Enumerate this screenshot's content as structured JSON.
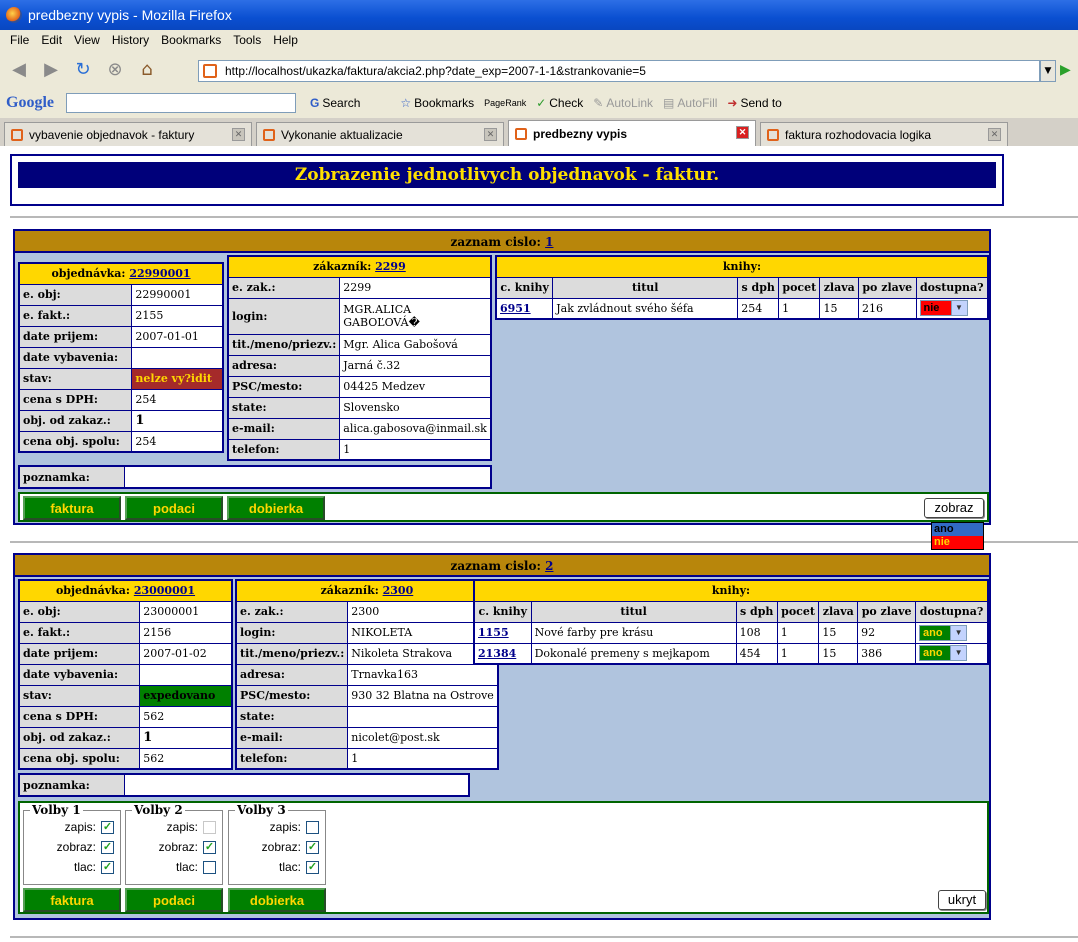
{
  "window": {
    "title": "predbezny vypis - Mozilla Firefox"
  },
  "menu": [
    "File",
    "Edit",
    "View",
    "History",
    "Bookmarks",
    "Tools",
    "Help"
  ],
  "url": "http://localhost/ukazka/faktura/akcia2.php?date_exp=2007-1-1&strankovanie=5",
  "toolbar": {
    "google": "Google",
    "search": "Search",
    "bookmarks": "Bookmarks",
    "pagerank": "PageRank",
    "check": "Check",
    "autolink": "AutoLink",
    "autofill": "AutoFill",
    "sendto": "Send to"
  },
  "tabs": [
    "vybavenie objednavok - faktury",
    "Vykonanie aktualizacie",
    "predbezny vypis",
    "faktura rozhodovacia logika"
  ],
  "page": {
    "header": "Zobrazenie jednotlivych objednavok - faktur."
  },
  "labels": {
    "zaznam": "zaznam cislo: ",
    "objednavka": "objednávka: ",
    "zakaznik": "zákazník: ",
    "knihy": "knihy:",
    "e_obj": "e. obj:",
    "e_fakt": "e. fakt.:",
    "date_prijem": "date prijem:",
    "date_vybavenia": "date vybavenia:",
    "stav": "stav:",
    "cena_dph": "cena s DPH:",
    "obj_zakaz": "obj. od zakaz.:",
    "cena_spolu": "cena obj. spolu:",
    "e_zak": "e. zak.:",
    "login": "login:",
    "tit": "tit./meno/priezv.:",
    "adresa": "adresa:",
    "psc": "PSC/mesto:",
    "state": "state:",
    "email": "e-mail:",
    "telefon": "telefon:",
    "poznamka": "poznamka:",
    "col_cknihy": "c. knihy",
    "col_titul": "titul",
    "col_sdph": "s dph",
    "col_pocet": "pocet",
    "col_zlava": "zlava",
    "col_pozlave": "po zlave",
    "col_dostupna": "dostupna?",
    "faktura": "faktura",
    "podaci": "podaci",
    "dobierka": "dobierka",
    "zobraz": "zobraz",
    "ukryt": "ukryt",
    "volby1": "Volby 1",
    "volby2": "Volby 2",
    "volby3": "Volby 3",
    "zapis": "zapis:",
    "zobraz_chk": "zobraz:",
    "tlac": "tlac:"
  },
  "records": [
    {
      "num": "1",
      "order": {
        "id": "22990001",
        "e_obj": "22990001",
        "e_fakt": "2155",
        "date_prijem": "2007-01-01",
        "date_vybavenia": "",
        "stav": "nelze vy?idit",
        "cena_dph": "254",
        "obj_zakaz": "1",
        "cena_spolu": "254"
      },
      "customer": {
        "id": "2299",
        "e_zak": "2299",
        "login": "MGR.ALICA GABOĽOVÁ�",
        "tit": "Mgr. Alica Gabošová",
        "adresa": "Jarná č.32",
        "psc": "04425 Medzev",
        "state": "Slovensko",
        "email": "alica.gabosova@inmail.sk",
        "telefon": "1"
      },
      "books": [
        {
          "cislo": "6951",
          "titul": "Jak zvládnout svého šéfa",
          "sdph": "254",
          "pocet": "1",
          "zlava": "15",
          "pozlave": "216",
          "dostupna": "nie"
        }
      ],
      "poznamka": ""
    },
    {
      "num": "2",
      "order": {
        "id": "23000001",
        "e_obj": "23000001",
        "e_fakt": "2156",
        "date_prijem": "2007-01-02",
        "date_vybavenia": "",
        "stav": "expedovano",
        "cena_dph": "562",
        "obj_zakaz": "1",
        "cena_spolu": "562"
      },
      "customer": {
        "id": "2300",
        "e_zak": "2300",
        "login": "NIKOLETA",
        "tit": "Nikoleta Strakova",
        "adresa": "Trnavka163",
        "psc": "930 32 Blatna na Ostrove",
        "state": "",
        "email": "nicolet@post.sk",
        "telefon": "1"
      },
      "books": [
        {
          "cislo": "1155",
          "titul": "Nové farby pre krásu",
          "sdph": "108",
          "pocet": "1",
          "zlava": "15",
          "pozlave": "92",
          "dostupna": "ano"
        },
        {
          "cislo": "21384",
          "titul": "Dokonalé premeny s mejkapom",
          "sdph": "454",
          "pocet": "1",
          "zlava": "15",
          "pozlave": "386",
          "dostupna": "ano"
        }
      ],
      "poznamka": "",
      "volby": [
        {
          "zapis": true,
          "zobraz": true,
          "tlac": true
        },
        {
          "zapis": false,
          "zobraz": true,
          "tlac": false
        },
        {
          "zapis": false,
          "zobraz": true,
          "tlac": true
        }
      ]
    }
  ],
  "dropdown_options": [
    "ano",
    "nie"
  ]
}
